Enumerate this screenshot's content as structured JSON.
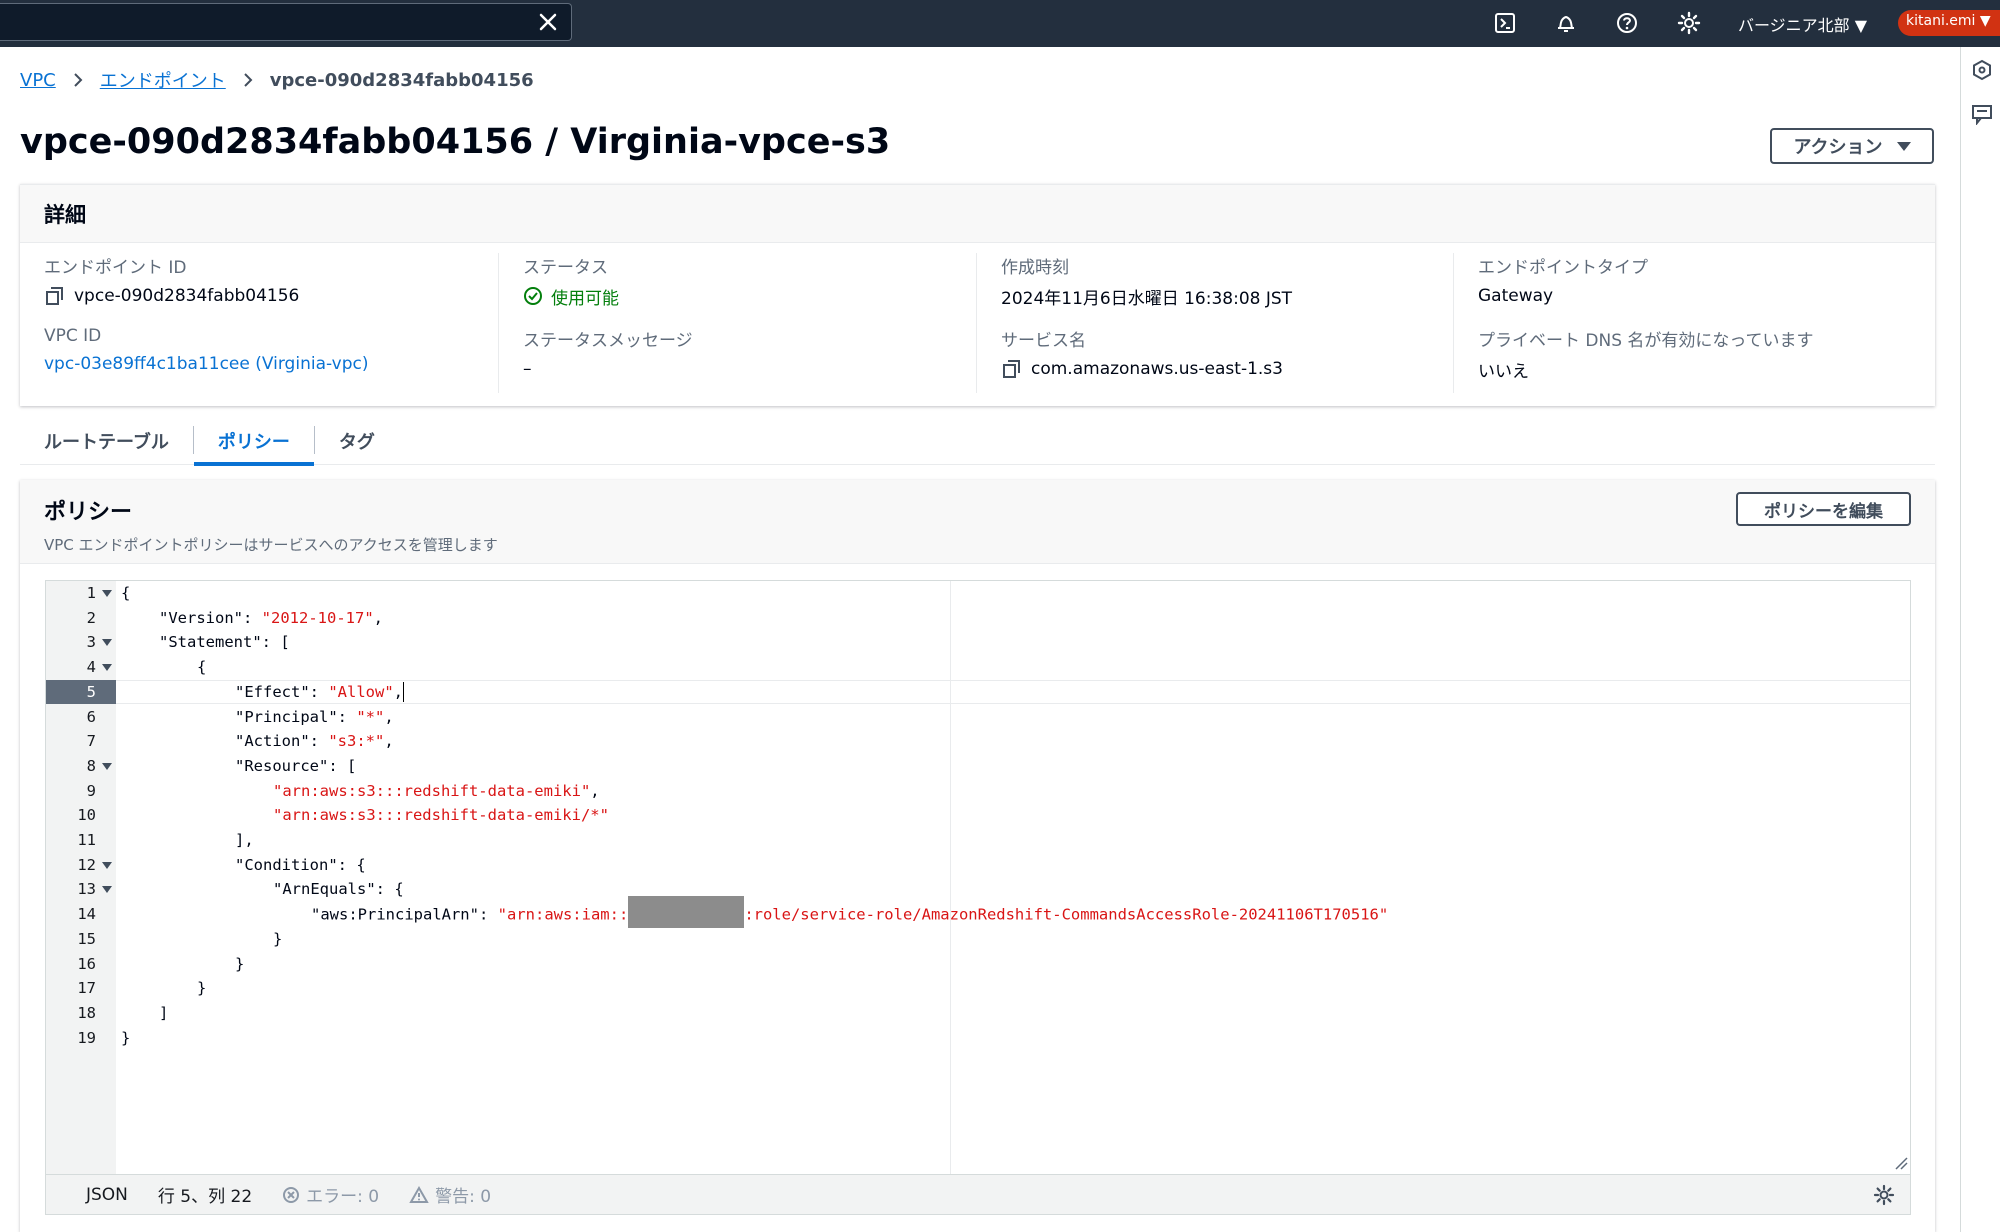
{
  "topbar": {
    "region": "バージニア北部 ▼",
    "user": "kitani.emi ▼",
    "icons": [
      "close-icon",
      "cloudshell-icon",
      "bell-icon",
      "help-icon",
      "settings-icon"
    ]
  },
  "breadcrumb": {
    "items": [
      "VPC",
      "エンドポイント"
    ],
    "current": "vpce-090d2834fabb04156"
  },
  "page": {
    "title": "vpce-090d2834fabb04156 / Virginia-vpce-s3",
    "actions_label": "アクション"
  },
  "details": {
    "header": "詳細",
    "endpoint_id_label": "エンドポイント ID",
    "endpoint_id": "vpce-090d2834fabb04156",
    "vpc_id_label": "VPC ID",
    "vpc_id": "vpc-03e89ff4c1ba11cee (Virginia-vpc)",
    "status_label": "ステータス",
    "status": "使用可能",
    "status_message_label": "ステータスメッセージ",
    "status_message": "–",
    "created_label": "作成時刻",
    "created": "2024年11月6日水曜日 16:38:08 JST",
    "service_label": "サービス名",
    "service": "com.amazonaws.us-east-1.s3",
    "type_label": "エンドポイントタイプ",
    "type": "Gateway",
    "private_dns_label": "プライベート DNS 名が有効になっています",
    "private_dns": "いいえ"
  },
  "tabs": [
    {
      "label": "ルートテーブル",
      "active": false
    },
    {
      "label": "ポリシー",
      "active": true
    },
    {
      "label": "タグ",
      "active": false
    }
  ],
  "policy": {
    "title": "ポリシー",
    "description": "VPC エンドポイントポリシーはサービスへのアクセスを管理します",
    "edit_label": "ポリシーを編集",
    "code": {
      "line1": "{",
      "l2_key": "\"Version\"",
      "l2_val": "\"2012-10-17\"",
      "l3_key": "\"Statement\"",
      "l3_rest": ": [",
      "line4": "{",
      "l5_key": "\"Effect\"",
      "l5_val": "\"Allow\"",
      "l6_key": "\"Principal\"",
      "l6_val": "\"*\"",
      "l7_key": "\"Action\"",
      "l7_val": "\"s3:*\"",
      "l8_key": "\"Resource\"",
      "l8_rest": ": [",
      "l9_val": "\"arn:aws:s3:::redshift-data-emiki\"",
      "l10_val": "\"arn:aws:s3:::redshift-data-emiki/*\"",
      "line11": "],",
      "l12_key": "\"Condition\"",
      "l12_rest": ": {",
      "l13_key": "\"ArnEquals\"",
      "l13_rest": ": {",
      "l14_key": "\"aws:PrincipalArn\"",
      "l14_val_start": "\"arn:aws:iam::",
      "l14_val_end": ":role/service-role/AmazonRedshift-CommandsAccessRole-20241106T170516\"",
      "line15": "}",
      "line16": "}",
      "line17": "}",
      "line18": "]",
      "line19": "}"
    },
    "line_numbers": [
      "1",
      "2",
      "3",
      "4",
      "5",
      "6",
      "7",
      "8",
      "9",
      "10",
      "11",
      "12",
      "13",
      "14",
      "15",
      "16",
      "17",
      "18",
      "19"
    ],
    "active_line": 5,
    "status": {
      "language": "JSON",
      "position": "行 5、列 22",
      "errors": "エラー: 0",
      "warnings": "警告: 0"
    }
  }
}
